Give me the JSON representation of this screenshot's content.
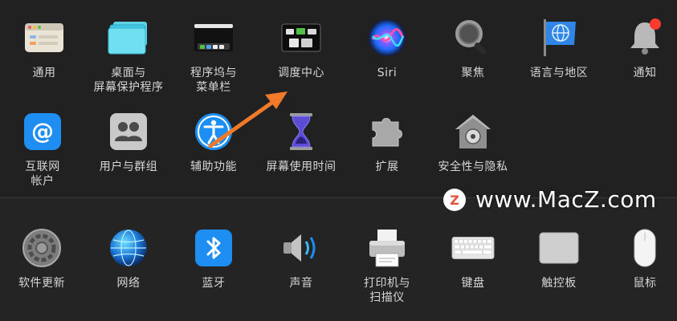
{
  "row1": [
    {
      "label": "通用",
      "icon": "general-icon"
    },
    {
      "label": "桌面与\n屏幕保护程序",
      "icon": "desktop-screensaver-icon"
    },
    {
      "label": "程序坞与\n菜单栏",
      "icon": "dock-menubar-icon"
    },
    {
      "label": "调度中心",
      "icon": "mission-control-icon"
    },
    {
      "label": "Siri",
      "icon": "siri-icon"
    },
    {
      "label": "聚焦",
      "icon": "spotlight-icon"
    },
    {
      "label": "语言与地区",
      "icon": "language-region-icon"
    },
    {
      "label": "通知",
      "icon": "notifications-icon"
    }
  ],
  "row2": [
    {
      "label": "互联网\n帐户",
      "icon": "internet-accounts-icon"
    },
    {
      "label": "用户与群组",
      "icon": "users-groups-icon"
    },
    {
      "label": "辅助功能",
      "icon": "accessibility-icon"
    },
    {
      "label": "屏幕使用时间",
      "icon": "screen-time-icon"
    },
    {
      "label": "扩展",
      "icon": "extensions-icon"
    },
    {
      "label": "安全性与隐私",
      "icon": "security-privacy-icon"
    }
  ],
  "row3": [
    {
      "label": "软件更新",
      "icon": "software-update-icon"
    },
    {
      "label": "网络",
      "icon": "network-icon"
    },
    {
      "label": "蓝牙",
      "icon": "bluetooth-icon"
    },
    {
      "label": "声音",
      "icon": "sound-icon"
    },
    {
      "label": "打印机与\n扫描仪",
      "icon": "printers-scanners-icon"
    },
    {
      "label": "键盘",
      "icon": "keyboard-icon"
    },
    {
      "label": "触控板",
      "icon": "trackpad-icon"
    },
    {
      "label": "鼠标",
      "icon": "mouse-icon"
    }
  ],
  "watermark": {
    "logo_letter": "Z",
    "text": "www.MacZ.com"
  },
  "colors": {
    "arrow": "#f07a2a",
    "background": "#1f1f1f",
    "label": "#d6d6d6"
  }
}
